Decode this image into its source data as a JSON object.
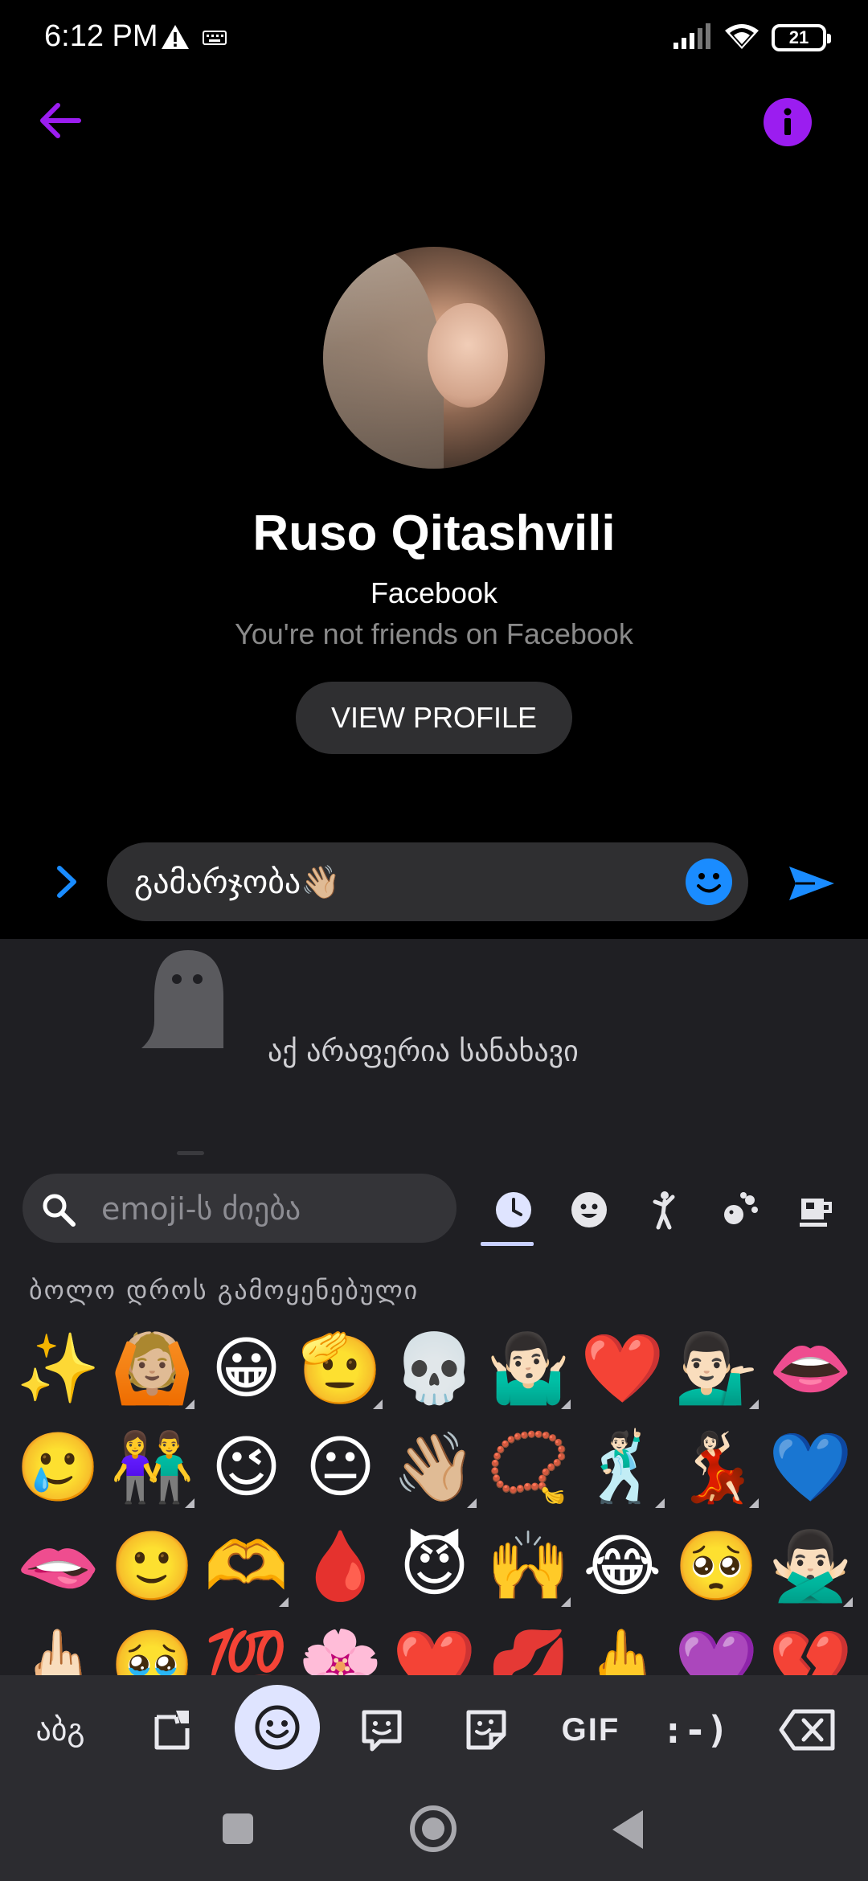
{
  "status_bar": {
    "time": "6:12 PM",
    "battery": "21",
    "icons": [
      "warning-icon",
      "keyboard-icon",
      "signal-icon",
      "wifi-icon",
      "battery-icon"
    ]
  },
  "header": {
    "back_icon": "arrow-left-icon",
    "info_icon": "info-icon",
    "accent_color": "#9b1df0"
  },
  "profile": {
    "name": "Ruso Qitashvili",
    "subtitle": "Facebook",
    "relationship": "You're not friends on Facebook",
    "view_profile_label": "VIEW PROFILE"
  },
  "composer": {
    "message": "გამარჯობა👋🏼",
    "emoji_icon": "smiley-icon",
    "send_icon": "send-icon",
    "accent_color": "#1a8cff"
  },
  "keyboard": {
    "empty_state": "აქ არაფერია სანახავი",
    "search_placeholder": "emoji-ს ძიება",
    "tabs": [
      {
        "icon": "clock-icon",
        "glyph": "🕓",
        "active": true
      },
      {
        "icon": "smiley-category-icon",
        "glyph": "☻",
        "active": false
      },
      {
        "icon": "person-category-icon",
        "glyph": "🏃",
        "active": false
      },
      {
        "icon": "animal-category-icon",
        "glyph": "✿",
        "active": false
      },
      {
        "icon": "food-category-icon",
        "glyph": "☕",
        "active": false
      },
      {
        "icon": "travel-category-icon",
        "glyph": "⛟",
        "active": false
      }
    ],
    "recent_label": "ბოლო დროს გამოყენებული",
    "emojis": [
      {
        "char": "✨",
        "variant": false
      },
      {
        "char": "🙆🏼",
        "variant": true
      },
      {
        "char": "😀",
        "variant": false
      },
      {
        "char": "🫡",
        "variant": true
      },
      {
        "char": "💀",
        "variant": false
      },
      {
        "char": "🤷🏻‍♂️",
        "variant": true
      },
      {
        "char": "❤️",
        "variant": false
      },
      {
        "char": "💁🏻‍♂️",
        "variant": true
      },
      {
        "char": "👄",
        "variant": false
      },
      {
        "char": "🥲",
        "variant": false
      },
      {
        "char": "👫",
        "variant": true
      },
      {
        "char": "😉",
        "variant": false
      },
      {
        "char": "😐",
        "variant": false
      },
      {
        "char": "👋🏼",
        "variant": true
      },
      {
        "char": "📿",
        "variant": false
      },
      {
        "char": "🕺🏻",
        "variant": true
      },
      {
        "char": "💃🏻",
        "variant": true
      },
      {
        "char": "💙",
        "variant": false
      },
      {
        "char": "🫦",
        "variant": false
      },
      {
        "char": "🙂",
        "variant": false
      },
      {
        "char": "🫶",
        "variant": true
      },
      {
        "char": "🩸",
        "variant": false
      },
      {
        "char": "😈",
        "variant": false
      },
      {
        "char": "🙌",
        "variant": true
      },
      {
        "char": "😂",
        "variant": false
      },
      {
        "char": "🥺",
        "variant": false
      },
      {
        "char": "🙅🏻‍♂️",
        "variant": true
      },
      {
        "char": "🖕🏻",
        "variant": true
      },
      {
        "char": "🥹",
        "variant": false
      },
      {
        "char": "💯",
        "variant": false
      },
      {
        "char": "🌸",
        "variant": false
      },
      {
        "char": "❤️",
        "variant": false
      },
      {
        "char": "💋",
        "variant": false
      },
      {
        "char": "🖕",
        "variant": true
      },
      {
        "char": "💜",
        "variant": false
      },
      {
        "char": "💔",
        "variant": false
      }
    ]
  },
  "toolbar": {
    "abc_label": "აბგ",
    "gif_label": "GIF",
    "emoticon_label": ":-)",
    "icons": [
      "clipboard-icon",
      "emoji-icon",
      "emoji-sticker-icon",
      "sticker-icon",
      "backspace-icon"
    ]
  },
  "nav": {
    "icons": [
      "recents-icon",
      "home-icon",
      "back-icon"
    ]
  }
}
